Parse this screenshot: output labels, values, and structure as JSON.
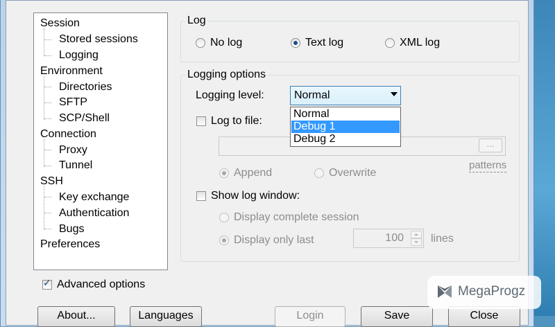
{
  "tree": {
    "items": [
      {
        "label": "Session"
      },
      {
        "label": "Stored sessions"
      },
      {
        "label": "Logging"
      },
      {
        "label": "Environment"
      },
      {
        "label": "Directories"
      },
      {
        "label": "SFTP"
      },
      {
        "label": "SCP/Shell"
      },
      {
        "label": "Connection"
      },
      {
        "label": "Proxy"
      },
      {
        "label": "Tunnel"
      },
      {
        "label": "SSH"
      },
      {
        "label": "Key exchange"
      },
      {
        "label": "Authentication"
      },
      {
        "label": "Bugs"
      },
      {
        "label": "Preferences"
      }
    ]
  },
  "log_group": {
    "title": "Log",
    "options": [
      "No log",
      "Text log",
      "XML log"
    ],
    "selected": "Text log"
  },
  "logging_options": {
    "title": "Logging options",
    "level_label": "Logging level:",
    "level_value": "Normal",
    "level_options": [
      "Normal",
      "Debug 1",
      "Debug 2"
    ],
    "level_highlighted": "Debug 1",
    "log_to_file_label": "Log to file:",
    "log_to_file_checked": false,
    "file_path": "",
    "browse_label": "...",
    "patterns_label": "patterns",
    "append_label": "Append",
    "overwrite_label": "Overwrite",
    "write_mode": "Append",
    "show_log_window_label": "Show log window:",
    "show_log_window_checked": false,
    "display_complete_label": "Display complete session",
    "display_last_label": "Display only last",
    "lines_value": "100",
    "lines_label": "lines"
  },
  "advanced_options": {
    "label": "Advanced options",
    "checked": true
  },
  "buttons": {
    "about": "About...",
    "languages": "Languages",
    "login": "Login",
    "save": "Save",
    "close": "Close"
  },
  "watermark": {
    "text": "MegaProgz"
  }
}
